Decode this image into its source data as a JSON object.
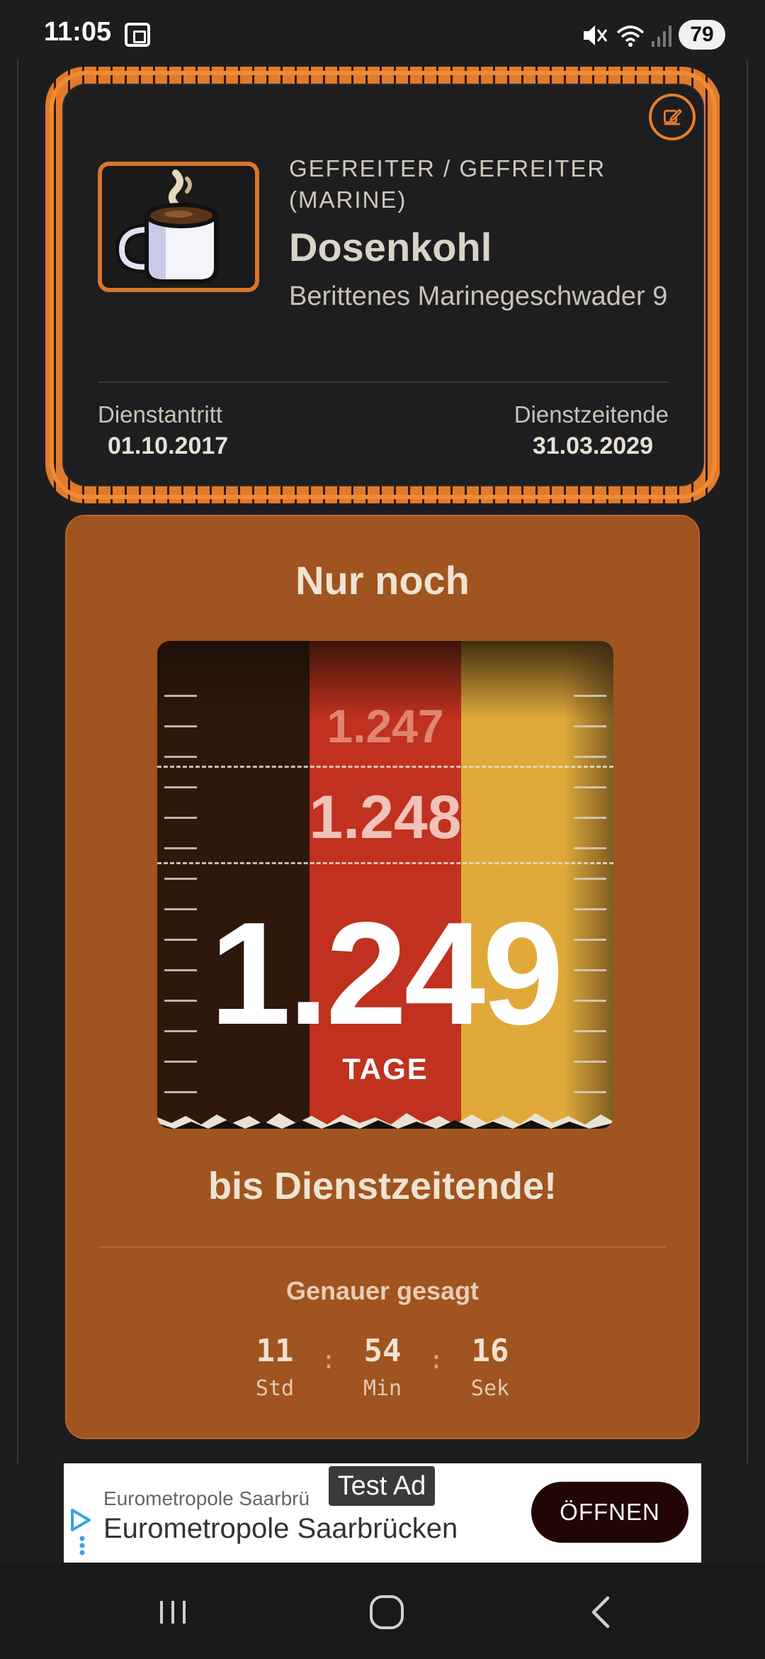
{
  "status_bar": {
    "time": "11:05",
    "battery": "79",
    "icons": [
      "screenshot-icon",
      "mute-icon",
      "wifi-icon",
      "signal-icon"
    ]
  },
  "profile": {
    "rank": "GEFREITER / GEFREITER (MARINE)",
    "name": "Dosenkohl",
    "unit": "Berittenes Marinegeschwader 9",
    "avatar_icon": "coffee-cup-icon",
    "start": {
      "label": "Dienstantritt",
      "value": "01.10.2017"
    },
    "end": {
      "label": "Dienstzeitende",
      "value": "31.03.2029"
    },
    "edit_icon": "edit-icon",
    "accent_color": "#e67e2e"
  },
  "countdown": {
    "headline": "Nur noch",
    "days_value": "1.249",
    "days_prev_1": "1.248",
    "days_prev_2": "1.247",
    "days_unit": "TAGE",
    "subline": "bis Dienstzeitende!",
    "precise_title": "Genauer gesagt",
    "timer": [
      {
        "value": "11",
        "label": "Std"
      },
      {
        "value": "54",
        "label": "Min"
      },
      {
        "value": "16",
        "label": "Sek"
      }
    ],
    "separator": ":",
    "flag_colors": [
      "#2d180c",
      "#c0311f",
      "#e0a93a"
    ],
    "card_color": "#a0541f"
  },
  "ad": {
    "badge": "Test Ad",
    "subtitle": "Eurometropole Saarbrü",
    "title": "Eurometropole Saarbrücken",
    "cta": "ÖFFNEN"
  },
  "nav": {
    "icons": [
      "recent-apps-icon",
      "home-icon",
      "back-icon"
    ]
  }
}
